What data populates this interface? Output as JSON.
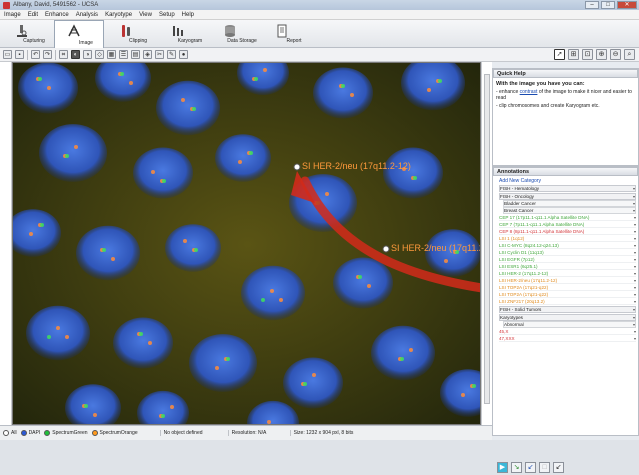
{
  "window": {
    "title": "Albany, David, 5491562 - UCSA"
  },
  "menu": [
    "Image",
    "Edit",
    "Enhance",
    "Analysis",
    "Karyotype",
    "View",
    "Setup",
    "Help"
  ],
  "ribbon": {
    "tabs": [
      {
        "label": "Capturing",
        "icon": "microscope-icon"
      },
      {
        "label": "Image",
        "icon": "image-icon",
        "active": true
      },
      {
        "label": "Clipping",
        "icon": "scissors-icon"
      },
      {
        "label": "Karyogram",
        "icon": "karyogram-icon"
      },
      {
        "label": "Data Storage",
        "icon": "database-icon"
      },
      {
        "label": "Report",
        "icon": "report-icon"
      }
    ]
  },
  "toolbar": {
    "left_icons": [
      "open-icon",
      "save-icon",
      "undo-icon",
      "redo-icon",
      "crop-icon",
      "contrast-icon",
      "invert-icon",
      "sharpen-icon",
      "grid-icon",
      "list-icon",
      "layers-icon",
      "adjust-icon",
      "cut-icon",
      "edit-icon",
      "color-icon"
    ],
    "right_icons": [
      "pointer-icon",
      "fit-icon",
      "zoom-region-icon",
      "zoom-in-icon",
      "zoom-out-icon",
      "zoom-dropdown-icon"
    ]
  },
  "image": {
    "annotations": [
      {
        "text": "SI HER-2/neu (17q11.2-12)",
        "color": "#ff9a3c"
      },
      {
        "text": "SI HER-2/neu (17q11.2-12)",
        "color": "#ff9a3c"
      }
    ]
  },
  "status": {
    "channels": [
      {
        "label": "All",
        "color": "#ffffff"
      },
      {
        "label": "DAPI",
        "color": "#2b59d6"
      },
      {
        "label": "SpectrumGreen",
        "color": "#1fbf3a"
      },
      {
        "label": "SpectrumOrange",
        "color": "#ff9a1e"
      }
    ],
    "object": "No object defined",
    "resolution": "Resolution: N/A",
    "size": "Size: 1232 x 904 pxl, 8 bits"
  },
  "quickhelp": {
    "header": "Quick Help",
    "heading": "With the image you have you can:",
    "line1_pre": "- enhance ",
    "line1_link": "contrast",
    "line1_post": " of the image to make it nicer and easier to read",
    "line2": "- clip chromosomes and create Karyogram etc."
  },
  "annotations_panel": {
    "header": "Annotations",
    "add": "Add New Category",
    "rows": [
      {
        "text": "FISH - Hematology",
        "type": "h",
        "color": "#222"
      },
      {
        "text": "FISH - Oncology",
        "type": "h",
        "color": "#222"
      },
      {
        "text": "Bladder Cancer",
        "type": "sub",
        "color": "#222"
      },
      {
        "text": "Breast Cancer",
        "type": "sub",
        "color": "#222"
      },
      {
        "text": "CEP 17 (17p11.1-q11.1 Alpha Satellite DNA)",
        "type": "item",
        "color": "#3fa63a"
      },
      {
        "text": "CEP 7 (7p11.1-q11.1 Alpha Satellite DNA)",
        "type": "item",
        "color": "#3fa63a"
      },
      {
        "text": "CEP 8 (8p11.1-q11.1 Alpha Satellite DNA)",
        "type": "item",
        "color": "#d3363a"
      },
      {
        "text": "LSI 1 (1q12)",
        "type": "item",
        "color": "#e08a1c"
      },
      {
        "text": "LSI C-MYC (8q24.12-q24.13)",
        "type": "item",
        "color": "#3fa63a"
      },
      {
        "text": "LSI Cyclin D1 (11q13)",
        "type": "item",
        "color": "#3fa63a"
      },
      {
        "text": "LSI EGFR (7p12)",
        "type": "item",
        "color": "#3fa63a"
      },
      {
        "text": "LSI ESR1 (6q25.1)",
        "type": "item",
        "color": "#3fa63a"
      },
      {
        "text": "LSI HER-2 (17q11.2-12)",
        "type": "item",
        "color": "#3fa63a"
      },
      {
        "text": "LSI HER-2/neu (17q11.2-12)",
        "type": "item",
        "color": "#e08a1c"
      },
      {
        "text": "LSI TOP2A (17q21-q22)",
        "type": "item",
        "color": "#e08a1c"
      },
      {
        "text": "LSI TOP2A (17q21-q22)",
        "type": "item",
        "color": "#e08a1c"
      },
      {
        "text": "LSI ZNF217 (20q13.2)",
        "type": "item",
        "color": "#e08a1c"
      },
      {
        "text": "FISH - Solid Tumors",
        "type": "h",
        "color": "#222"
      },
      {
        "text": "Karyotypes",
        "type": "h",
        "color": "#222"
      },
      {
        "text": "Abnormal",
        "type": "sub",
        "color": "#222"
      },
      {
        "text": "45,X",
        "type": "item",
        "color": "#d3363a"
      },
      {
        "text": "47,XXX",
        "type": "item",
        "color": "#d3363a"
      }
    ],
    "buttons": [
      "play-icon",
      "next-icon",
      "apply-icon",
      "stop-icon",
      "export-icon"
    ]
  }
}
